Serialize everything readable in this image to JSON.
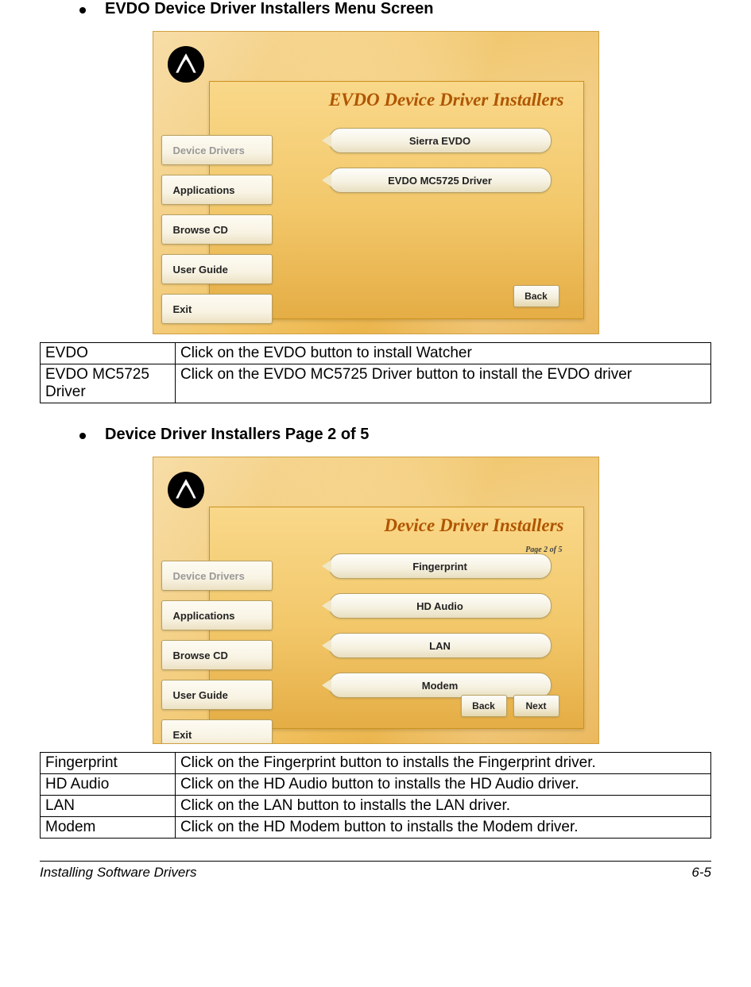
{
  "section1": {
    "heading": "EVDO Device Driver Installers Menu Screen",
    "installer": {
      "title": "EVDO Device Driver Installers",
      "left_tabs": [
        {
          "label": "Device Drivers",
          "disabled": true
        },
        {
          "label": "Applications",
          "disabled": false
        },
        {
          "label": "Browse CD",
          "disabled": false
        },
        {
          "label": "User Guide",
          "disabled": false
        },
        {
          "label": "Exit",
          "disabled": false
        }
      ],
      "right_buttons": [
        "Sierra EVDO",
        "EVDO MC5725 Driver"
      ],
      "nav": {
        "back": "Back"
      }
    },
    "table": [
      {
        "name": "EVDO",
        "desc": "Click on the EVDO button to install Watcher"
      },
      {
        "name": "EVDO MC5725 Driver",
        "desc": "Click on the EVDO MC5725 Driver button to install the EVDO driver"
      }
    ]
  },
  "section2": {
    "heading": "Device Driver Installers Page 2 of 5",
    "installer": {
      "title": "Device Driver Installers",
      "page_of": "Page 2 of 5",
      "left_tabs": [
        {
          "label": "Device Drivers",
          "disabled": true
        },
        {
          "label": "Applications",
          "disabled": false
        },
        {
          "label": "Browse CD",
          "disabled": false
        },
        {
          "label": "User Guide",
          "disabled": false
        },
        {
          "label": "Exit",
          "disabled": false
        }
      ],
      "right_buttons": [
        "Fingerprint",
        "HD Audio",
        "LAN",
        "Modem"
      ],
      "nav": {
        "back": "Back",
        "next": "Next"
      }
    },
    "table": [
      {
        "name": "Fingerprint",
        "desc": "Click on the Fingerprint button to installs the Fingerprint driver."
      },
      {
        "name": "HD Audio",
        "desc": "Click on the HD Audio button to installs the HD Audio driver."
      },
      {
        "name": "LAN",
        "desc": "Click on the LAN button to installs the LAN driver."
      },
      {
        "name": "Modem",
        "desc": "Click on the HD Modem button to installs the Modem driver."
      }
    ]
  },
  "footer": {
    "left": "Installing Software Drivers",
    "right": "6-5"
  }
}
